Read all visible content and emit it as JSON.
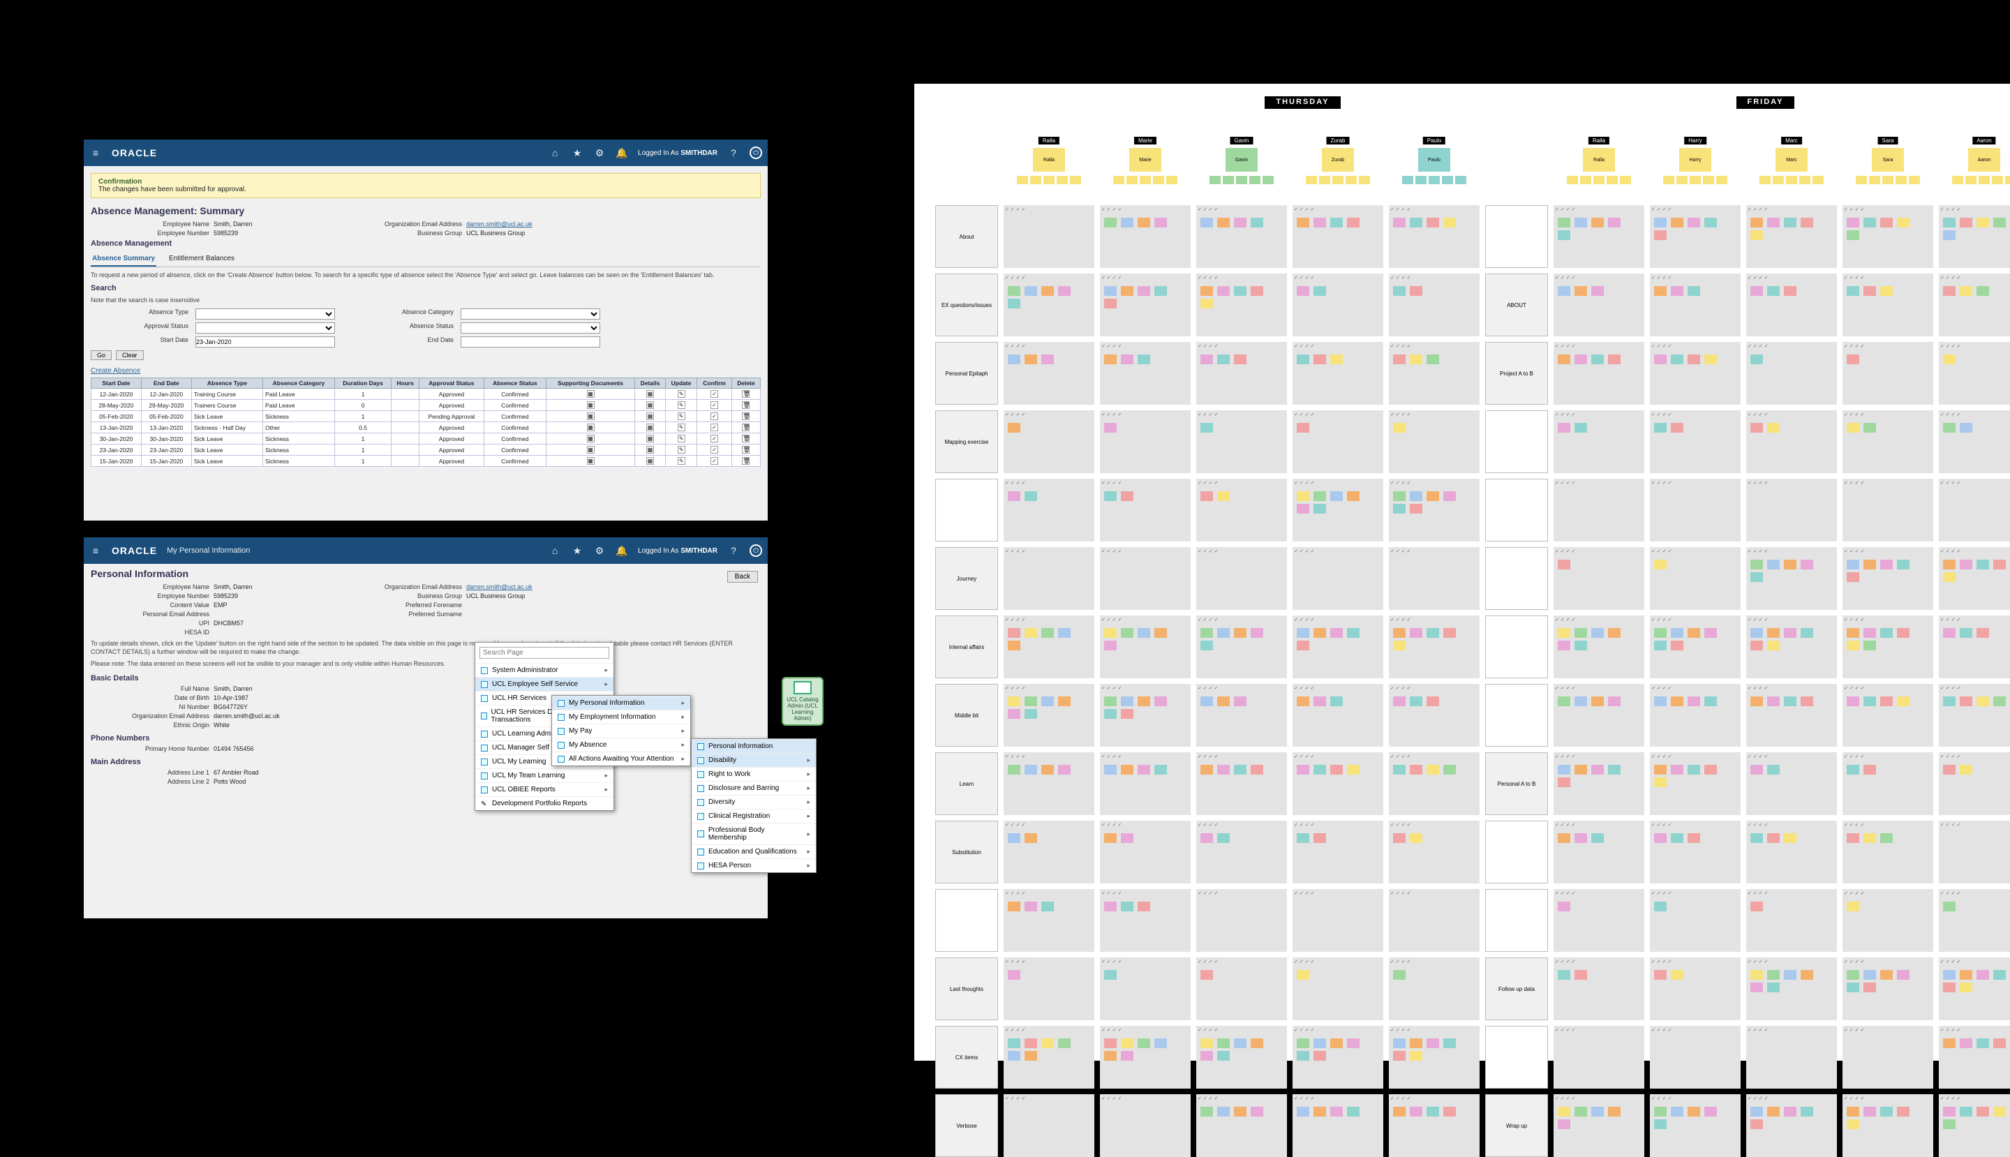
{
  "oracle_common": {
    "brand": "ORACLE",
    "logged_in_prefix": "Logged In As",
    "logged_in_user": "SMITHDAR"
  },
  "scr1": {
    "banner_title": "Confirmation",
    "banner_msg": "The changes have been submitted for approval.",
    "page_title": "Absence Management: Summary",
    "emp": {
      "name_label": "Employee Name",
      "name": "Smith, Darren",
      "number_label": "Employee Number",
      "number": "5985239",
      "org_email_label": "Organization Email Address",
      "org_email": "darren.smith@ucl.ac.uk",
      "bg_label": "Business Group",
      "bg": "UCL Business Group"
    },
    "section2": "Absence Management",
    "tabs": {
      "a": "Absence Summary",
      "b": "Entitlement Balances"
    },
    "intro": "To request a new period of absence, click on the 'Create Absence' button below. To search for a specific type of absence select the 'Absence Type' and select go. Leave balances can be seen on the 'Entitlement Balances' tab.",
    "search_label": "Search",
    "note": "Note that the search is case insensitive",
    "fields": {
      "absence_type": "Absence Type",
      "absence_category": "Absence Category",
      "approval_status": "Approval Status",
      "absence_status": "Absence Status",
      "start_date": "Start Date",
      "end_date": "End Date",
      "start_date_val": "23-Jan-2020"
    },
    "go": "Go",
    "clear": "Clear",
    "create_absence": "Create Absence",
    "columns": [
      "Start Date",
      "End Date",
      "Absence Type",
      "Absence Category",
      "Duration Days",
      "Hours",
      "Approval Status",
      "Absence Status",
      "Supporting Documents",
      "Details",
      "Update",
      "Confirm",
      "Delete"
    ],
    "rows": [
      {
        "sd": "12-Jan-2020",
        "ed": "12-Jan-2020",
        "type": "Training Course",
        "cat": "Paid Leave",
        "dur": "1",
        "hrs": "",
        "appr": "Approved",
        "stat": "Confirmed"
      },
      {
        "sd": "28-May-2020",
        "ed": "29-May-2020",
        "type": "Trainers Course",
        "cat": "Paid Leave",
        "dur": "0",
        "hrs": "",
        "appr": "Approved",
        "stat": "Confirmed"
      },
      {
        "sd": "05-Feb-2020",
        "ed": "05-Feb-2020",
        "type": "Sick Leave",
        "cat": "Sickness",
        "dur": "1",
        "hrs": "",
        "appr": "Pending Approval",
        "stat": "Confirmed"
      },
      {
        "sd": "13-Jan-2020",
        "ed": "13-Jan-2020",
        "type": "Sickness - Half Day",
        "cat": "Other",
        "dur": "0.5",
        "hrs": "",
        "appr": "Approved",
        "stat": "Confirmed"
      },
      {
        "sd": "30-Jan-2020",
        "ed": "30-Jan-2020",
        "type": "Sick Leave",
        "cat": "Sickness",
        "dur": "1",
        "hrs": "",
        "appr": "Approved",
        "stat": "Confirmed"
      },
      {
        "sd": "23-Jan-2020",
        "ed": "23-Jan-2020",
        "type": "Sick Leave",
        "cat": "Sickness",
        "dur": "1",
        "hrs": "",
        "appr": "Approved",
        "stat": "Confirmed"
      },
      {
        "sd": "15-Jan-2020",
        "ed": "15-Jan-2020",
        "type": "Sick Leave",
        "cat": "Sickness",
        "dur": "1",
        "hrs": "",
        "appr": "Approved",
        "stat": "Confirmed"
      }
    ]
  },
  "scr2": {
    "subtitle": "My Personal Information",
    "page_title": "Personal Information",
    "back": "Back",
    "emp": {
      "name_label": "Employee Name",
      "name": "Smith, Darren",
      "number_label": "Employee Number",
      "number": "5985239",
      "cv_label": "Content Value",
      "cv": "EMP",
      "pemail_label": "Personal Email Address",
      "pemail": "",
      "upi_label": "UPI",
      "upi": "DHCBM57",
      "hesa_label": "HESA ID",
      "hesa": "",
      "org_email_label": "Organization Email Address",
      "org_email": "darren.smith@ucl.ac.uk",
      "bg_label": "Business Group",
      "bg": "UCL Business Group",
      "pref_fn_label": "Preferred Forename",
      "pref_fn": "",
      "pref_sn_label": "Preferred Surname",
      "pref_sn": ""
    },
    "help1": "To update details shown, click on the 'Update' button on the right hand side of the section to be updated. The data visible on this page is managed by your department; if the data is not updatable please contact HR Services (ENTER CONTACT DETAILS) a further window will be required to make the change.",
    "help2": "Please note: The data entered on these screens will not be visible to your manager and is only visible within Human Resources.",
    "basic_title": "Basic Details",
    "basic": {
      "full_name_label": "Full Name",
      "full_name": "Smith, Darren",
      "dob_label": "Date of Birth",
      "dob": "10-Apr-1987",
      "ni_label": "NI Number",
      "ni": "BG647726Y",
      "org_email_label": "Organization Email Address",
      "org_email": "darren.smith@ucl.ac.uk",
      "eo_label": "Ethnic Origin",
      "eo": "White"
    },
    "phone_title": "Phone Numbers",
    "phone_label": "Primary Home Number",
    "phone": "01494 765456",
    "addr_title": "Main Address",
    "addr1_label": "Address Line 1",
    "addr1": "67 Ambler Road",
    "addr2_label": "Address Line 2",
    "addr2": "Potts Wood"
  },
  "menus": {
    "search_placeholder": "Search Page",
    "menu1": [
      "System Administrator",
      "UCL Employee Self Service",
      "UCL HR Services",
      "UCL HR Services Department Transactions",
      "UCL Learning Administrator",
      "UCL Manager Self Service",
      "UCL My Learning",
      "UCL My Team Learning",
      "UCL OBIEE Reports"
    ],
    "dev_portfolio": "Development Portfolio Reports",
    "menu2": [
      "My Personal Information",
      "My Employment Information",
      "My Pay",
      "My Absence",
      "All Actions Awaiting Your Attention"
    ],
    "menu3_header": "Personal Information",
    "menu3": [
      "Disability",
      "Right to Work",
      "Disclosure and Barring",
      "Diversity",
      "Clinical Registration",
      "Professional Body Membership",
      "Education and Qualifications",
      "HESA Person"
    ],
    "app_tile": "UCL Catalog Admin (UCL Learning Admin)"
  },
  "board": {
    "day_thu": "THURSDAY",
    "day_fri": "FRIDAY",
    "col_names_thu": [
      "Ralla",
      "Marie",
      "Gavin",
      "Zurab",
      "Paulo"
    ],
    "col_names_fri": [
      "Ralla",
      "Harry",
      "Marc",
      "Sara",
      "Aaron"
    ],
    "row_labels": [
      "About",
      "EX questions/issues",
      "Personal Epitaph",
      "Mapping exercise",
      "",
      "Journey",
      "Internal affairs",
      "Middle bit",
      "Learn",
      "Substitution",
      "",
      "Last thoughts",
      "CX items",
      "Verbose"
    ],
    "side_right": [
      "",
      "ABOUT",
      "Project A to B",
      "",
      "",
      "",
      "",
      "",
      "Personal A to B",
      "",
      "",
      "Follow up data",
      "",
      "Wrap up"
    ]
  }
}
